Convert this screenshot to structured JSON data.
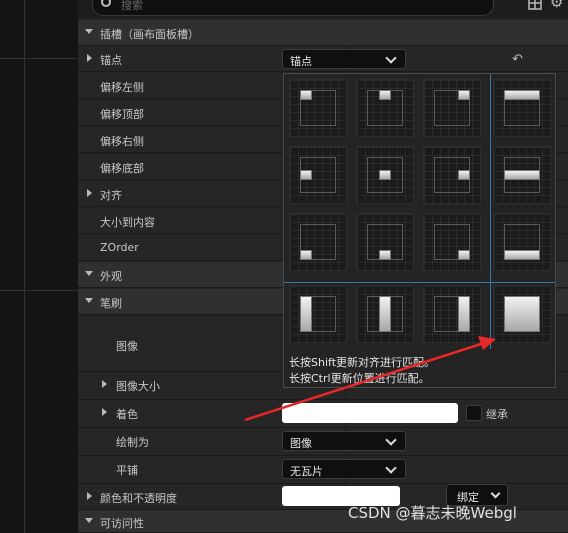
{
  "search": {
    "placeholder": "搜索"
  },
  "sections": {
    "slot": "插槽（画布面板槽）",
    "appearance": "外观",
    "brush": "笔刷",
    "accessibility": "可访问性"
  },
  "props": {
    "anchors": "锚点",
    "offset_left": "偏移左侧",
    "offset_top": "偏移顶部",
    "offset_right": "偏移右侧",
    "offset_bottom": "偏移底部",
    "alignment": "对齐",
    "size_to_content": "大小到内容",
    "zorder": "ZOrder",
    "image": "图像",
    "image_size": "图像大小",
    "tint": "着色",
    "draw_as": "绘制为",
    "tiling": "平铺",
    "color_opacity": "颜色和不透明度"
  },
  "values": {
    "anchors_dropdown": "锚点",
    "draw_as_dropdown": "图像",
    "tiling_dropdown": "无瓦片",
    "inherit_label": "继承",
    "bind_button": "绑定"
  },
  "popup": {
    "hint_line1": "长按Shift更新对齐进行匹配。",
    "hint_line2": "长按Ctrl更新位置进行匹配。"
  },
  "watermark": "CSDN @暮志未晚Webgl"
}
